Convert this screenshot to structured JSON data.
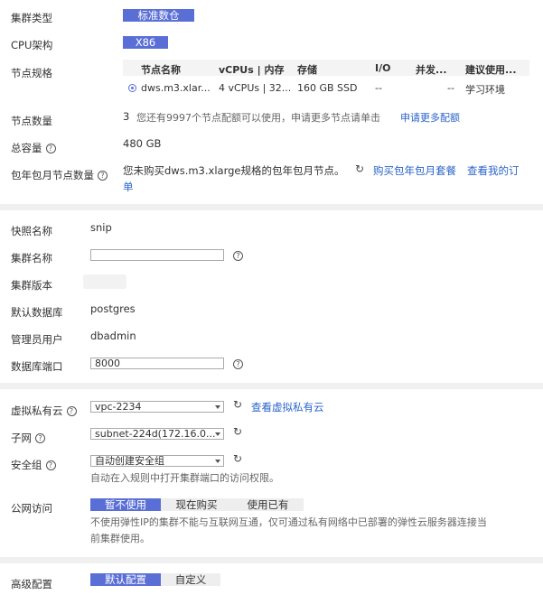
{
  "cluster_type": {
    "label": "集群类型",
    "value": "标准数仓"
  },
  "cpu_arch": {
    "label": "CPU架构",
    "value": "X86"
  },
  "node_spec": {
    "label": "节点规格",
    "headers": [
      "节点名称",
      "vCPUs | 内存",
      "存储",
      "I/O",
      "并发...",
      "建议使用..."
    ],
    "row": [
      "dws.m3.xlar...",
      "4 vCPUs | 32...",
      "160 GB SSD",
      "--",
      "--",
      "学习环境"
    ]
  },
  "node_count": {
    "label": "节点数量",
    "value": "3",
    "quota_text": "您还有9997个节点配额可以使用，申请更多节点请单击",
    "quota_link": "申请更多配额"
  },
  "total_capacity": {
    "label": "总容量",
    "value": "480 GB"
  },
  "yearly_nodes": {
    "label": "包年包月节点数量",
    "text": "您未购买dws.m3.xlarge规格的包年包月节点。",
    "buy_link": "购买包年包月套餐",
    "view_link_1": "查看我的订",
    "view_link_2": "单"
  },
  "snapshot_name": {
    "label": "快照名称",
    "value": "snip"
  },
  "cluster_name": {
    "label": "集群名称",
    "value": ""
  },
  "cluster_version": {
    "label": "集群版本",
    "value": ""
  },
  "default_db": {
    "label": "默认数据库",
    "value": "postgres"
  },
  "admin_user": {
    "label": "管理员用户",
    "value": "dbadmin"
  },
  "db_port": {
    "label": "数据库端口",
    "value": "8000"
  },
  "vpc": {
    "label": "虚拟私有云",
    "value": "vpc-2234",
    "link": "查看虚拟私有云"
  },
  "subnet": {
    "label": "子网",
    "value": "subnet-224d(172.16.0..."
  },
  "security_group": {
    "label": "安全组",
    "value": "自动创建安全组",
    "hint": "自动在入规则中打开集群端口的访问权限。"
  },
  "public_access": {
    "label": "公网访问",
    "options": [
      "暂不使用",
      "现在购买",
      "使用已有"
    ],
    "hint_1": "不使用弹性IP的集群不能与互联网互通，仅可通过私有网络中已部署的弹性云服务器连接当",
    "hint_2": "前集群使用。"
  },
  "advanced": {
    "label": "高级配置",
    "options": [
      "默认配置",
      "自定义"
    ]
  },
  "colors": {
    "accent": "#5a6fd6",
    "link": "#2a64c9",
    "divider": "#f0f0f0"
  }
}
